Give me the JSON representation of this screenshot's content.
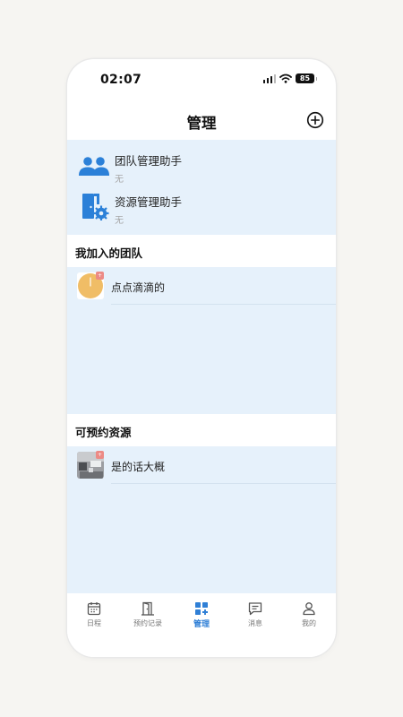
{
  "status_bar": {
    "time": "02:07",
    "battery": "85"
  },
  "header": {
    "title": "管理",
    "add_icon": "plus-circle-icon"
  },
  "assistants": [
    {
      "title": "团队管理助手",
      "subtitle": "无",
      "icon": "team-icon"
    },
    {
      "title": "资源管理助手",
      "subtitle": "无",
      "icon": "resource-settings-icon"
    }
  ],
  "sections": {
    "teams": {
      "title": "我加入的团队",
      "items": [
        {
          "label": "点点滴滴的",
          "badge": "+"
        }
      ]
    },
    "resources": {
      "title": "可预约资源",
      "items": [
        {
          "label": "是的话大概",
          "badge": "+"
        }
      ]
    }
  },
  "tabs": [
    {
      "label": "日程",
      "icon": "calendar-icon",
      "active": false
    },
    {
      "label": "预约记录",
      "icon": "door-icon",
      "active": false
    },
    {
      "label": "管理",
      "icon": "grid-plus-icon",
      "active": true
    },
    {
      "label": "消息",
      "icon": "message-icon",
      "active": false
    },
    {
      "label": "我的",
      "icon": "user-icon",
      "active": false
    }
  ],
  "colors": {
    "accent": "#2f7fd6",
    "content_bg": "#e6f1fb",
    "badge": "#ec8a85"
  }
}
